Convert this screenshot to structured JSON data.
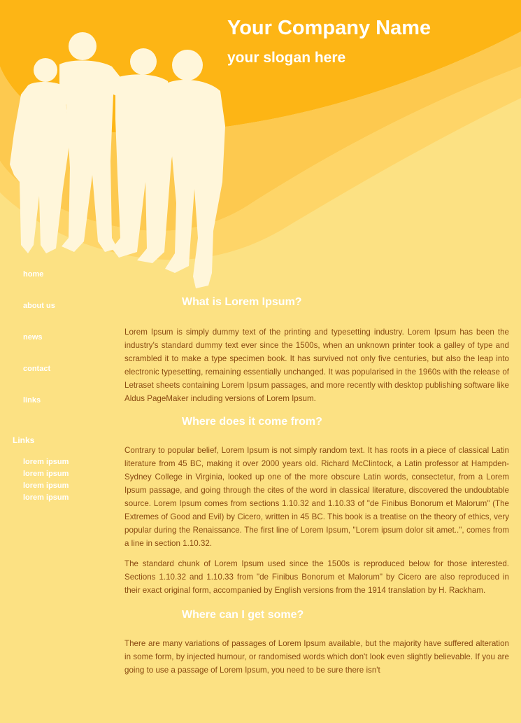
{
  "header": {
    "title": "Your Company Name",
    "slogan": "your slogan here"
  },
  "nav": {
    "items": [
      {
        "label": "home"
      },
      {
        "label": "about us"
      },
      {
        "label": "news"
      },
      {
        "label": "contact"
      },
      {
        "label": "links"
      }
    ]
  },
  "sidebar": {
    "links_heading": "Links",
    "links": [
      {
        "label": "lorem ipsum"
      },
      {
        "label": "lorem ipsum"
      },
      {
        "label": "lorem ipsum"
      },
      {
        "label": "lorem ipsum"
      }
    ]
  },
  "content": {
    "sections": [
      {
        "heading": "What is Lorem Ipsum?",
        "paragraphs": [
          "Lorem Ipsum is simply dummy text of the printing and typesetting industry. Lorem Ipsum has been the industry's standard dummy text ever since the 1500s, when an unknown printer took a galley of type and scrambled it to make a type specimen book. It has survived not only five centuries, but also the leap into electronic typesetting, remaining essentially unchanged. It was popularised in the 1960s with the release of Letraset sheets containing Lorem Ipsum passages, and more recently with desktop publishing software like Aldus PageMaker including versions of Lorem Ipsum."
        ]
      },
      {
        "heading": "Where does it come from?",
        "paragraphs": [
          "Contrary to popular belief, Lorem Ipsum is not simply random text. It has roots in a piece of classical Latin literature from 45 BC, making it over 2000 years old. Richard McClintock, a Latin professor at Hampden-Sydney College in Virginia, looked up one of the more obscure Latin words, consectetur, from a Lorem Ipsum passage, and going through the cites of the word in classical literature, discovered the undoubtable source. Lorem Ipsum comes from sections 1.10.32 and 1.10.33 of \"de Finibus Bonorum et Malorum\" (The Extremes of Good and Evil) by Cicero, written in 45 BC. This book is a treatise on the theory of ethics, very popular during the Renaissance. The first line of Lorem Ipsum, \"Lorem ipsum dolor sit amet..\", comes from a line in section 1.10.32.",
          "The standard chunk of Lorem Ipsum used since the 1500s is reproduced below for those interested. Sections 1.10.32 and 1.10.33 from \"de Finibus Bonorum et Malorum\" by Cicero are also reproduced in their exact original form, accompanied by English versions from the 1914 translation by H. Rackham."
        ]
      },
      {
        "heading": "Where can I get some?",
        "paragraphs": [
          "There are many variations of passages of Lorem Ipsum available, but the majority have suffered alteration in some form, by injected humour, or randomised words which don't look even slightly believable. If you are going to use a passage of Lorem Ipsum, you need to be sure there isn't"
        ]
      }
    ]
  },
  "colors": {
    "page_background": "#fce183",
    "header_orange": "#fdb515",
    "header_mid": "#fdc94f",
    "wave_light": "#fed568",
    "silhouette": "#fff6da",
    "heading_text": "#ffffff",
    "body_text": "#8a4a12"
  }
}
